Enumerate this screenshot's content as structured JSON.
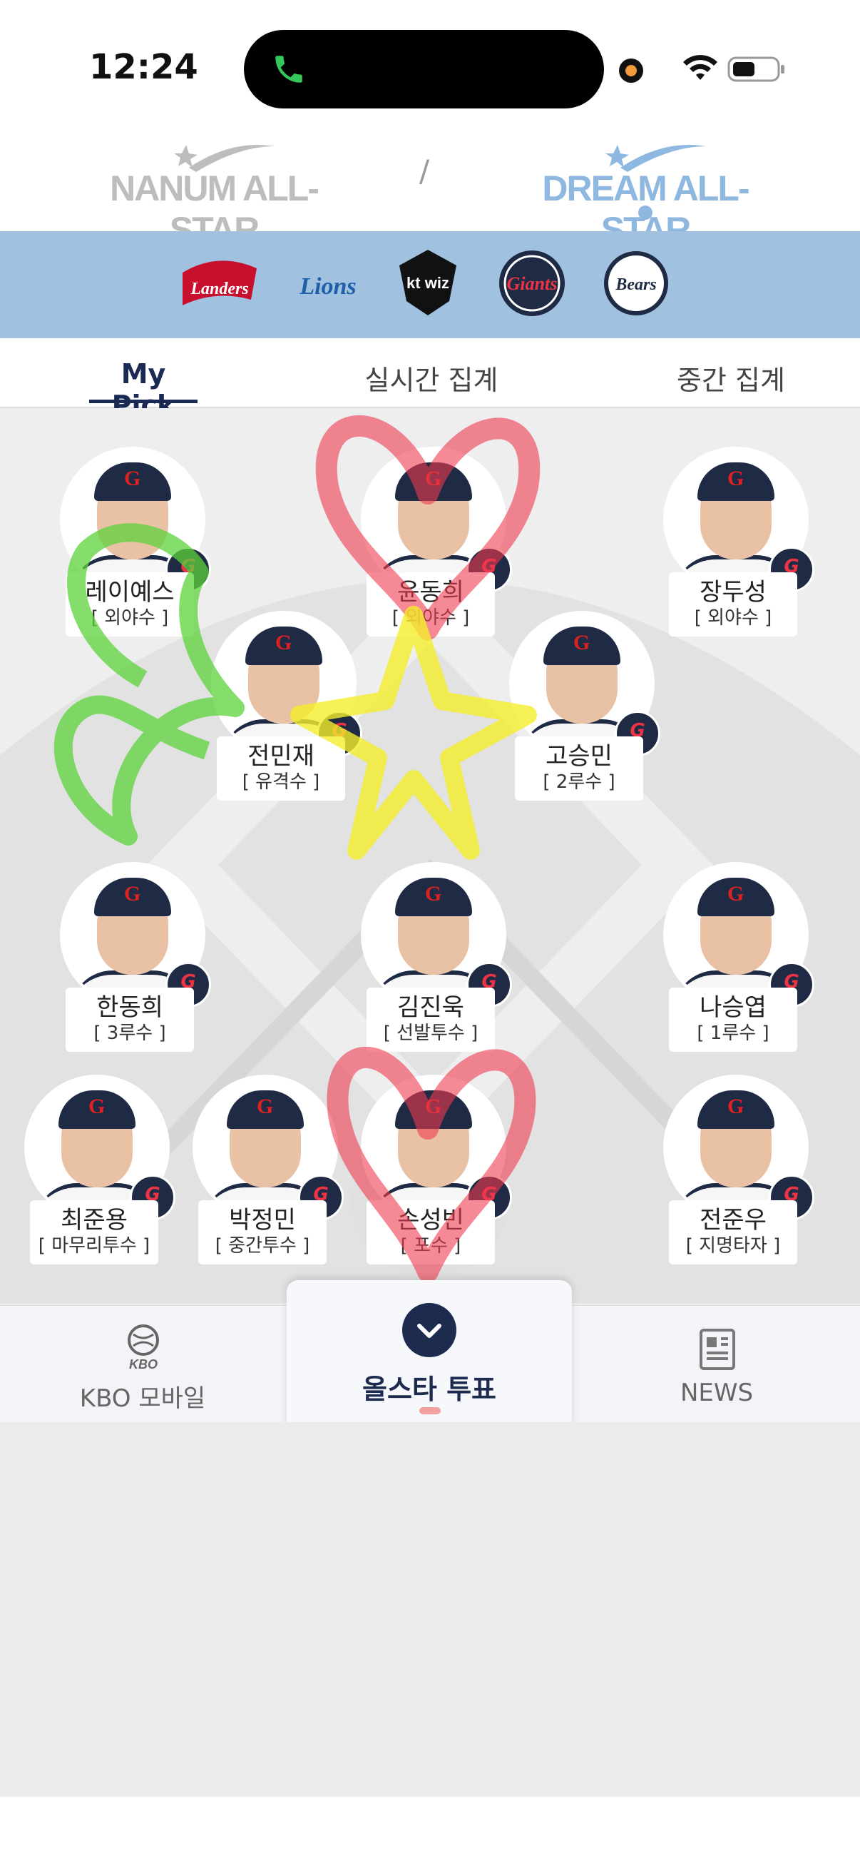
{
  "status_bar": {
    "time": "12:24"
  },
  "allstar": {
    "nanum": "NANUM ALL-STAR",
    "separator": "/",
    "dream": "DREAM ALL-STAR"
  },
  "teams": [
    "Landers",
    "Lions",
    "kt wiz",
    "Giants",
    "Bears"
  ],
  "tabs": [
    "My Pick",
    "실시간 집계",
    "중간 집계"
  ],
  "players": [
    {
      "name": "레이예스",
      "position": "[ 외야수 ]"
    },
    {
      "name": "윤동희",
      "position": "[ 외야수 ]"
    },
    {
      "name": "장두성",
      "position": "[ 외야수 ]"
    },
    {
      "name": "전민재",
      "position": "[ 유격수 ]"
    },
    {
      "name": "고승민",
      "position": "[ 2루수 ]"
    },
    {
      "name": "한동희",
      "position": "[ 3루수 ]"
    },
    {
      "name": "김진욱",
      "position": "[ 선발투수 ]"
    },
    {
      "name": "나승엽",
      "position": "[ 1루수 ]"
    },
    {
      "name": "최준용",
      "position": "[ 마무리투수 ]"
    },
    {
      "name": "박정민",
      "position": "[ 중간투수 ]"
    },
    {
      "name": "손성빈",
      "position": "[ 포수 ]"
    },
    {
      "name": "전준우",
      "position": "[ 지명타자 ]"
    }
  ],
  "badge_team": "Giants",
  "bottom_nav": {
    "kbo": "KBO 모바일",
    "vote": "올스타 투표",
    "news": "NEWS",
    "kbo_logo_text": "KBO"
  },
  "icons": [
    "phone-icon",
    "wifi-icon",
    "battery-icon",
    "chevron-down-icon",
    "news-icon",
    "kbo-logo-icon"
  ],
  "colors": {
    "team_bar": "#a0c1e0",
    "accent_navy": "#1b2a55",
    "dream_blue": "#8fb8e0"
  }
}
